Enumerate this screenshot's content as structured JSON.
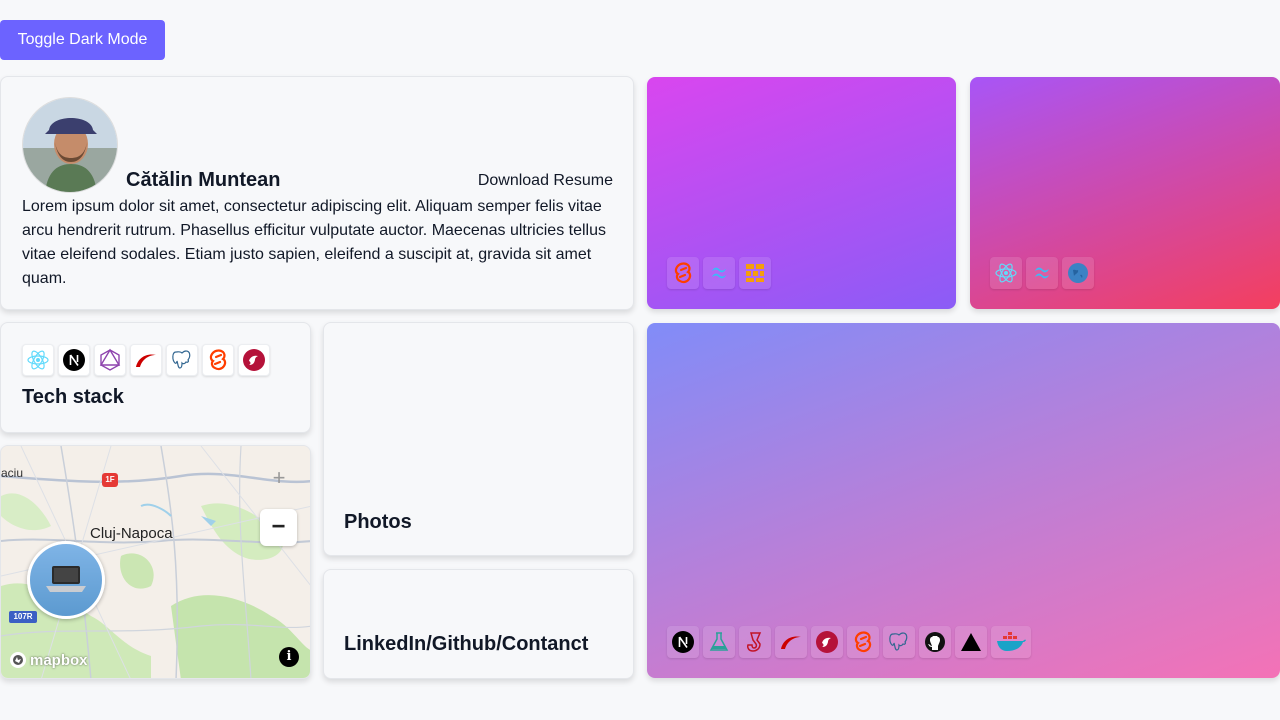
{
  "toolbar": {
    "toggle_label": "Toggle Dark Mode"
  },
  "profile": {
    "name": "Cătălin Muntean",
    "download_label": "Download Resume",
    "bio": "Lorem ipsum dolor sit amet, consectetur adipiscing elit. Aliquam semper felis vitae arcu hendrerit rutrum. Phasellus efficitur vulputate auctor. Maecenas ultricies tellus vitae eleifend sodales. Etiam justo sapien, eleifend a suscipit at, gravida sit amet quam."
  },
  "tech_stack": {
    "title": "Tech stack",
    "icons": [
      "react-icon",
      "nextjs-icon",
      "graphql-icon",
      "rails-icon",
      "postgresql-icon",
      "svelte-icon",
      "nestjs-icon"
    ]
  },
  "photos": {
    "title": "Photos"
  },
  "links": {
    "title": "LinkedIn/Github/Contanct"
  },
  "map": {
    "city": "Cluj-Napoca",
    "edge_text": "aciu",
    "road_badge_1": "1F",
    "road_badge_2": "107R",
    "brand": "mapbox",
    "zoom_in": "+",
    "zoom_out": "−",
    "info": "i"
  },
  "projects": [
    {
      "icons": [
        "svelte-icon",
        "tailwind-icon",
        "grid-blocks-icon"
      ],
      "gradient": [
        "#d946ef",
        "#8b5cf6"
      ]
    },
    {
      "icons": [
        "react-icon",
        "tailwind-icon",
        "globe-icon"
      ],
      "gradient": [
        "#a855f7",
        "#f43f5e"
      ]
    },
    {
      "icons": [
        "nextjs-icon",
        "flask-icon",
        "jest-icon",
        "rails-icon",
        "nestjs-icon",
        "svelte-icon",
        "postgresql-icon",
        "github-icon",
        "vercel-icon",
        "docker-icon"
      ],
      "gradient": [
        "#818cf8",
        "#f472b6"
      ]
    }
  ],
  "colors": {
    "accent": "#6c63ff",
    "background": "#f7f8fa",
    "text": "#111827"
  }
}
